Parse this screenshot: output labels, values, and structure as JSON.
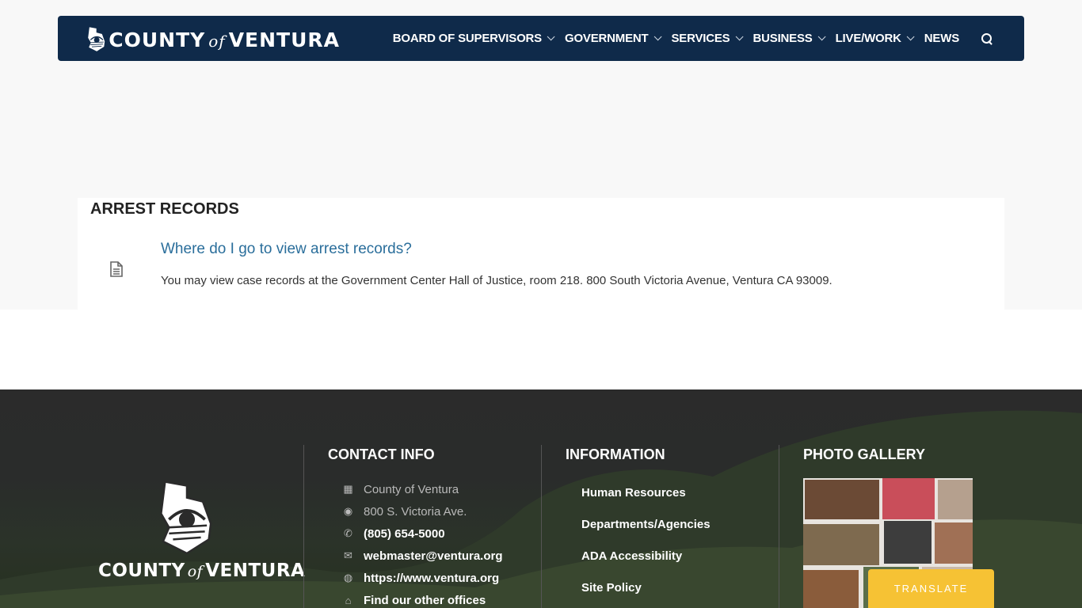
{
  "header": {
    "logo": {
      "county": "COUNTY",
      "of": "of",
      "ventura": "VENTURA"
    },
    "nav": [
      {
        "label": "BOARD OF SUPERVISORS",
        "has_dropdown": true
      },
      {
        "label": "GOVERNMENT",
        "has_dropdown": true
      },
      {
        "label": "SERVICES",
        "has_dropdown": true
      },
      {
        "label": "BUSINESS",
        "has_dropdown": true
      },
      {
        "label": "LIVE/WORK",
        "has_dropdown": true
      },
      {
        "label": "NEWS",
        "has_dropdown": false
      }
    ],
    "search_icon": "search-icon"
  },
  "main": {
    "section_title": "ARREST RECORDS",
    "item": {
      "icon": "document-icon",
      "question": "Where do I go to view arrest records?",
      "answer": "You may view case records at the Government Center Hall of Justice, room 218. 800 South Victoria Avenue, Ventura CA 93009."
    }
  },
  "footer": {
    "logo": {
      "county": "COUNTY",
      "of": "of",
      "ventura": "VENTURA"
    },
    "contact": {
      "title": "CONTACT INFO",
      "items": [
        {
          "icon": "building-icon",
          "text": "County of Ventura",
          "style": "dim"
        },
        {
          "icon": "map-pin-icon",
          "text": "800 S. Victoria Ave.",
          "style": "dim"
        },
        {
          "icon": "phone-icon",
          "text": "(805) 654-5000",
          "style": "bright"
        },
        {
          "icon": "envelope-icon",
          "text": "webmaster@ventura.org",
          "style": "bright"
        },
        {
          "icon": "globe-icon",
          "text": "https://www.ventura.org",
          "style": "bright"
        },
        {
          "icon": "bank-icon",
          "text": "Find our other offices",
          "style": "bright"
        }
      ]
    },
    "information": {
      "title": "INFORMATION",
      "items": [
        "Human Resources",
        "Departments/Agencies",
        "ADA Accessibility",
        "Site Policy"
      ]
    },
    "gallery": {
      "title": "PHOTO GALLERY"
    }
  },
  "translate": {
    "label": "TRANSLATE"
  },
  "colors": {
    "header_bg": "#0f2a4a",
    "link": "#2a6e9b",
    "translate_bg": "#f6c234"
  }
}
